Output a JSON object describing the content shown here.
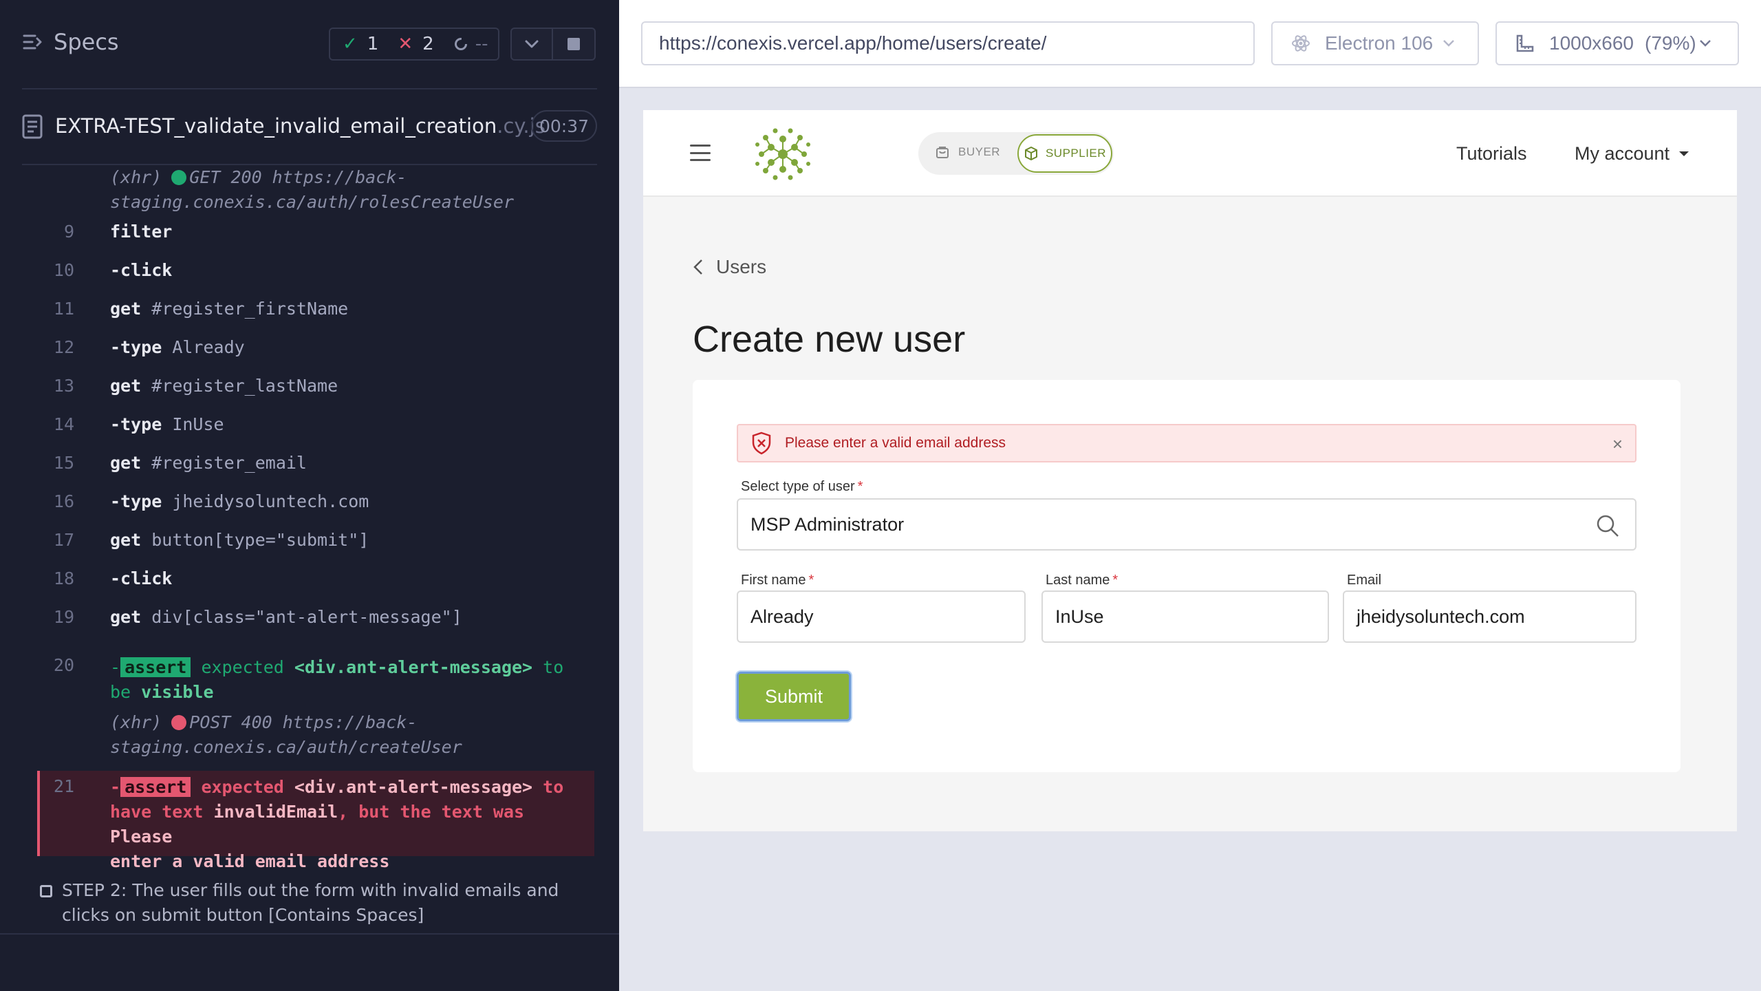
{
  "runner": {
    "specs_label": "Specs",
    "passed_count": "1",
    "failed_count": "2",
    "pending_count": "--",
    "spec_file": "EXTRA-TEST_validate_invalid_email_creation",
    "spec_ext": ".cy.js",
    "duration": "00:37",
    "log": {
      "xhr1": {
        "prefix": "(xhr)",
        "method_status": "GET 200 https://back-",
        "url_cont": "staging.conexis.ca/auth/rolesCreateUser"
      },
      "lines": [
        {
          "num": "9",
          "cmd": "filter",
          "arg": ""
        },
        {
          "num": "10",
          "cmd": "-click",
          "arg": ""
        },
        {
          "num": "11",
          "cmd": "get",
          "arg": "#register_firstName"
        },
        {
          "num": "12",
          "cmd": "-type",
          "arg": "Already"
        },
        {
          "num": "13",
          "cmd": "get",
          "arg": "#register_lastName"
        },
        {
          "num": "14",
          "cmd": "-type",
          "arg": "InUse"
        },
        {
          "num": "15",
          "cmd": "get",
          "arg": "#register_email"
        },
        {
          "num": "16",
          "cmd": "-type",
          "arg": "jheidysoluntech.com"
        },
        {
          "num": "17",
          "cmd": "get",
          "arg": "button[type=\"submit\"]"
        },
        {
          "num": "18",
          "cmd": "-click",
          "arg": ""
        },
        {
          "num": "19",
          "cmd": "get",
          "arg": "div[class=\"ant-alert-message\"]"
        }
      ],
      "assert_pass": {
        "num": "20",
        "badge": "assert",
        "expected": "expected",
        "subject": "<div.ant-alert-message>",
        "to": "to",
        "be": "be",
        "value": "visible"
      },
      "xhr2": {
        "prefix": "(xhr)",
        "method_status": "POST 400 https://back-",
        "url_cont": "staging.conexis.ca/auth/createUser"
      },
      "assert_fail": {
        "num": "21",
        "badge": "assert",
        "expected": "expected",
        "subject": "<div.ant-alert-message>",
        "to": "to",
        "have_text": "have text",
        "expected_val": "invalidEmail",
        "but": ", but the text was",
        "actual_1": "Please",
        "actual_2": "enter a valid email address"
      }
    },
    "step2": "STEP 2: The user fills out the form with invalid emails and clicks on submit button [Contains Spaces]"
  },
  "browser_toolbar": {
    "url": "https://conexis.vercel.app/home/users/create/",
    "browser": "Electron 106",
    "viewport": "1000x660",
    "zoom": "(79%)"
  },
  "app": {
    "buyer_label": "BUYER",
    "supplier_label": "SUPPLIER",
    "tutorials": "Tutorials",
    "account": "My account",
    "back_label": "Users",
    "title": "Create new user",
    "alert": "Please enter a valid email address",
    "user_type_label": "Select type of user",
    "user_type_value": "MSP Administrator",
    "first_label": "First name",
    "first_value": "Already",
    "last_label": "Last name",
    "last_value": "InUse",
    "email_label": "Email",
    "email_value": "jheidysoluntech.com",
    "required_mark": "*",
    "submit": "Submit"
  },
  "colors": {
    "runner_bg": "#1b1e2e",
    "pass": "#1fa971",
    "fail": "#e45770",
    "brand_green": "#8ab33b",
    "alert_text": "#b01d22"
  }
}
